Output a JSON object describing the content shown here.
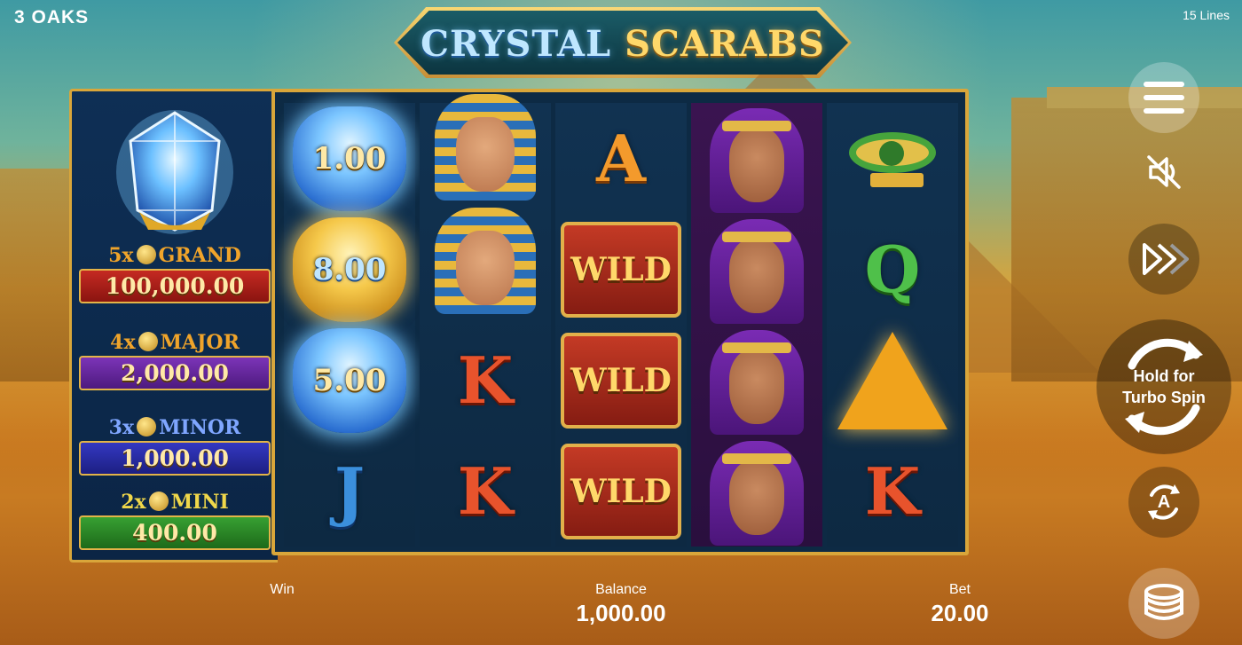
{
  "brand": "3 OAKS",
  "lines_label": "15 Lines",
  "logo": {
    "word1": "CRYSTAL",
    "word2": "SCARABS"
  },
  "jackpots": [
    {
      "mult": "5x",
      "name": "GRAND",
      "value": "100,000.00",
      "color": "#b4201b",
      "label_color": "#f0a42a"
    },
    {
      "mult": "4x",
      "name": "MAJOR",
      "value": "2,000.00",
      "color": "#6b2aa0",
      "label_color": "#f0a42a"
    },
    {
      "mult": "3x",
      "name": "MINOR",
      "value": "1,000.00",
      "color": "#2b2fa8",
      "label_color": "#7fa6ff"
    },
    {
      "mult": "2x",
      "name": "MINI",
      "value": "400.00",
      "color": "#2e8a2a",
      "label_color": "#f0d74a"
    }
  ],
  "reels": [
    [
      "scarab-blue:1.00",
      "scarab-gold:8.00",
      "scarab-blue:5.00",
      "J"
    ],
    [
      "pharaoh",
      "pharaoh",
      "K",
      "K"
    ],
    [
      "A",
      "WILD",
      "WILD",
      "WILD"
    ],
    [
      "queen",
      "queen",
      "queen",
      "queen"
    ],
    [
      "eye",
      "Q",
      "pyramid-gem",
      "K"
    ]
  ],
  "symbols": {
    "scarab_values": [
      "1.00",
      "8.00",
      "5.00"
    ],
    "wild_label": "WILD",
    "letters": {
      "a": "A",
      "k": "K",
      "q": "Q",
      "j": "J"
    }
  },
  "controls": {
    "spin_line1": "Hold for",
    "spin_line2": "Turbo Spin",
    "auto_label": "A"
  },
  "bottom": {
    "win_label": "Win",
    "balance_label": "Balance",
    "balance_value": "1,000.00",
    "bet_label": "Bet",
    "bet_value": "20.00"
  }
}
